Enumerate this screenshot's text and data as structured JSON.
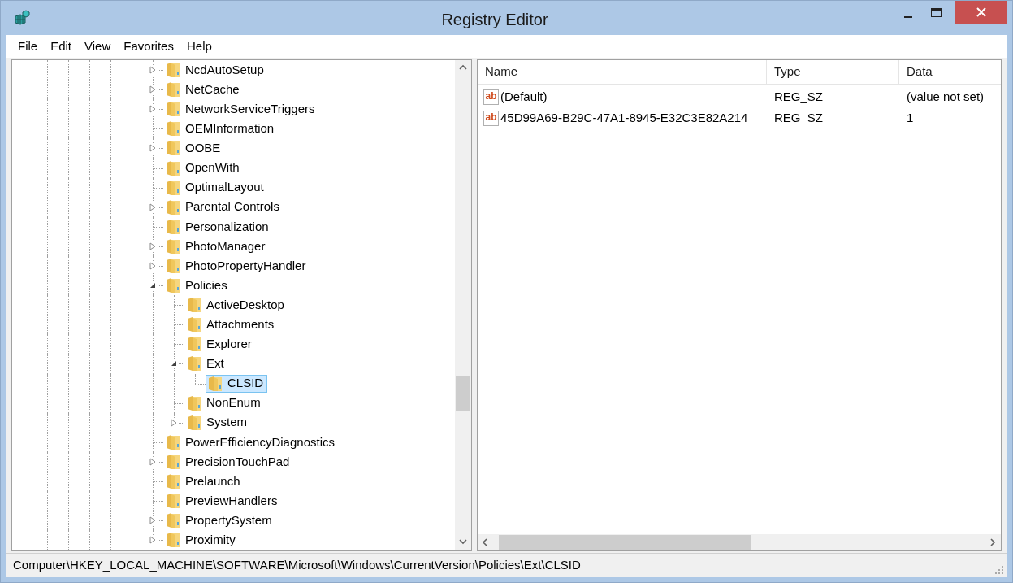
{
  "window": {
    "title": "Registry Editor"
  },
  "menu": [
    "File",
    "Edit",
    "View",
    "Favorites",
    "Help"
  ],
  "tree": {
    "items": [
      {
        "label": "NcdAutoSetup",
        "kind": "collapsed",
        "selected": false
      },
      {
        "label": "NetCache",
        "kind": "collapsed",
        "selected": false
      },
      {
        "label": "NetworkServiceTriggers",
        "kind": "collapsed",
        "selected": false
      },
      {
        "label": "OEMInformation",
        "kind": "leaf",
        "selected": false
      },
      {
        "label": "OOBE",
        "kind": "collapsed",
        "selected": false
      },
      {
        "label": "OpenWith",
        "kind": "leaf",
        "selected": false
      },
      {
        "label": "OptimalLayout",
        "kind": "leaf",
        "selected": false
      },
      {
        "label": "Parental Controls",
        "kind": "collapsed",
        "selected": false
      },
      {
        "label": "Personalization",
        "kind": "leaf",
        "selected": false
      },
      {
        "label": "PhotoManager",
        "kind": "collapsed",
        "selected": false
      },
      {
        "label": "PhotoPropertyHandler",
        "kind": "collapsed",
        "selected": false
      },
      {
        "label": "Policies",
        "kind": "expanded",
        "selected": false,
        "children": [
          {
            "label": "ActiveDesktop",
            "kind": "leaf",
            "selected": false
          },
          {
            "label": "Attachments",
            "kind": "leaf",
            "selected": false
          },
          {
            "label": "Explorer",
            "kind": "leaf",
            "selected": false
          },
          {
            "label": "Ext",
            "kind": "expanded",
            "selected": false,
            "children": [
              {
                "label": "CLSID",
                "kind": "leaf",
                "selected": true
              }
            ]
          },
          {
            "label": "NonEnum",
            "kind": "leaf",
            "selected": false
          },
          {
            "label": "System",
            "kind": "collapsed",
            "selected": false
          }
        ]
      },
      {
        "label": "PowerEfficiencyDiagnostics",
        "kind": "leaf",
        "selected": false
      },
      {
        "label": "PrecisionTouchPad",
        "kind": "collapsed",
        "selected": false
      },
      {
        "label": "Prelaunch",
        "kind": "leaf",
        "selected": false
      },
      {
        "label": "PreviewHandlers",
        "kind": "leaf",
        "selected": false
      },
      {
        "label": "PropertySystem",
        "kind": "collapsed",
        "selected": false
      },
      {
        "label": "Proximity",
        "kind": "collapsed",
        "selected": false
      }
    ]
  },
  "list": {
    "columns": [
      "Name",
      "Type",
      "Data"
    ],
    "rows": [
      {
        "icon_label": "ab",
        "name": "(Default)",
        "type": "REG_SZ",
        "data": "(value not set)"
      },
      {
        "icon_label": "ab",
        "name": "45D99A69-B29C-47A1-8945-E32C3E82A214",
        "type": "REG_SZ",
        "data": "1"
      }
    ]
  },
  "status_bar": "Computer\\HKEY_LOCAL_MACHINE\\SOFTWARE\\Microsoft\\Windows\\CurrentVersion\\Policies\\Ext\\CLSID"
}
